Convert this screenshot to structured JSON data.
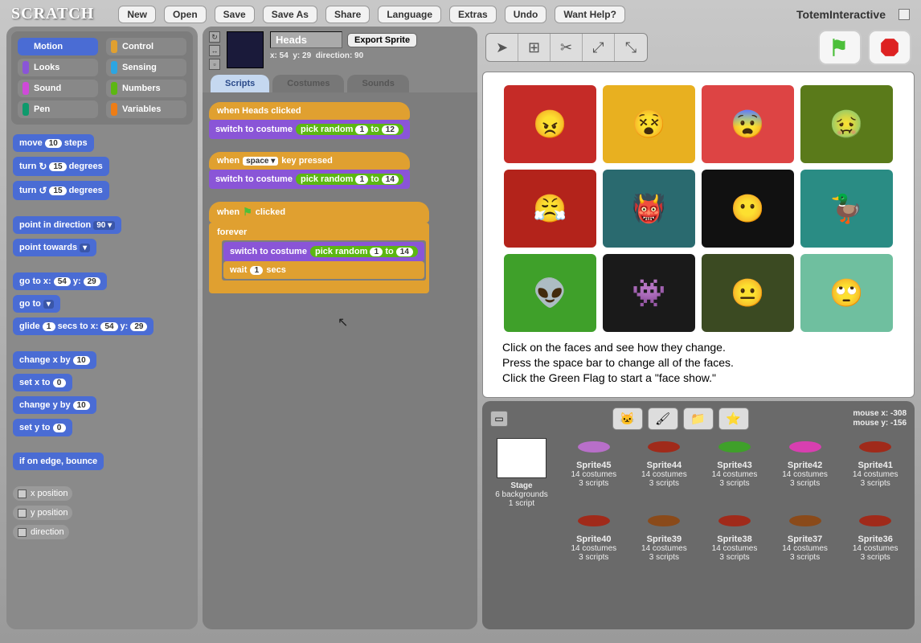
{
  "app": {
    "logo": "SCRATCH",
    "username": "TotemInteractive"
  },
  "menu": [
    "New",
    "Open",
    "Save",
    "Save As",
    "Share",
    "Language",
    "Extras",
    "Undo",
    "Want Help?"
  ],
  "categories": [
    {
      "name": "Motion",
      "color": "#4a6cd4",
      "active": true
    },
    {
      "name": "Control",
      "color": "#e0a030"
    },
    {
      "name": "Looks",
      "color": "#8a55d7"
    },
    {
      "name": "Sensing",
      "color": "#2ca5e2"
    },
    {
      "name": "Sound",
      "color": "#cf4ad9"
    },
    {
      "name": "Numbers",
      "color": "#5cb712"
    },
    {
      "name": "Pen",
      "color": "#0e9a6c"
    },
    {
      "name": "Variables",
      "color": "#ee7d16"
    }
  ],
  "motion_blocks": {
    "move_a": "move",
    "move_b": "steps",
    "move_n": "10",
    "turn_cw_a": "turn",
    "turn_cw_b": "degrees",
    "turn_cw_n": "15",
    "turn_ccw_a": "turn",
    "turn_ccw_b": "degrees",
    "turn_ccw_n": "15",
    "point_dir": "point in direction",
    "point_dir_n": "90 ▾",
    "point_toward": "point towards",
    "point_toward_v": "▾",
    "goto_xy": "go to x:",
    "goto_xy_x": "54",
    "goto_xy_mid": "y:",
    "goto_xy_y": "29",
    "goto": "go to",
    "goto_v": "▾",
    "glide_a": "glide",
    "glide_n": "1",
    "glide_b": "secs to x:",
    "glide_x": "54",
    "glide_c": "y:",
    "glide_y": "29",
    "chx": "change x by",
    "chx_n": "10",
    "setx": "set x to",
    "setx_n": "0",
    "chy": "change y by",
    "chy_n": "10",
    "sety": "set y to",
    "sety_n": "0",
    "bounce": "if on edge, bounce",
    "rep_x": "x position",
    "rep_y": "y position",
    "rep_d": "direction"
  },
  "sprite": {
    "name": "Heads",
    "x": "x: 54",
    "y": "y: 29",
    "dir": "direction: 90",
    "export": "Export Sprite",
    "tabs": [
      "Scripts",
      "Costumes",
      "Sounds"
    ],
    "active_tab": 0
  },
  "scripts": {
    "hat1": "when Heads clicked",
    "switch": "switch to costume",
    "pick": "pick random",
    "pick_a": "1",
    "pick_b1": "12",
    "pick_b2": "14",
    "pick_b3": "14",
    "hat2_a": "when",
    "hat2_key": "space ▾",
    "hat2_b": "key pressed",
    "hat3_a": "when",
    "hat3_b": "clicked",
    "forever": "forever",
    "wait_a": "wait",
    "wait_n": "1",
    "wait_b": "secs"
  },
  "stage_text": {
    "l1": "Click on the faces and see how they change.",
    "l2": "Press the space bar to change all of the faces.",
    "l3": "Click the Green Flag to start a \"face show.\""
  },
  "faces": [
    {
      "bg": "#c52b27",
      "emoji": "😠"
    },
    {
      "bg": "#e8b020",
      "emoji": "😵"
    },
    {
      "bg": "#d44",
      "emoji": "😨"
    },
    {
      "bg": "#5a7a1a",
      "emoji": "🤢"
    },
    {
      "bg": "#b3231b",
      "emoji": "😤"
    },
    {
      "bg": "#2a6a6f",
      "emoji": "👹"
    },
    {
      "bg": "#111",
      "emoji": "😶"
    },
    {
      "bg": "#2a8c84",
      "emoji": "🦆"
    },
    {
      "bg": "#3fa02a",
      "emoji": "👽"
    },
    {
      "bg": "#1a1a1a",
      "emoji": "👾"
    },
    {
      "bg": "#3b4a22",
      "emoji": "😐"
    },
    {
      "bg": "#6fbf9f",
      "emoji": "🙄"
    }
  ],
  "mouse": {
    "x": "mouse x:  -308",
    "y": "mouse y:  -156"
  },
  "stage_item": {
    "name": "Stage",
    "sub1": "6 backgrounds",
    "sub2": "1 script"
  },
  "sprites": [
    {
      "name": "Sprite45",
      "c": "14 costumes",
      "s": "3 scripts",
      "color": "#b86fc9"
    },
    {
      "name": "Sprite44",
      "c": "14 costumes",
      "s": "3 scripts",
      "color": "#a02a1a"
    },
    {
      "name": "Sprite43",
      "c": "14 costumes",
      "s": "3 scripts",
      "color": "#3fa02a"
    },
    {
      "name": "Sprite42",
      "c": "14 costumes",
      "s": "3 scripts",
      "color": "#d83fb0"
    },
    {
      "name": "Sprite41",
      "c": "14 costumes",
      "s": "3 scripts",
      "color": "#a02a1a"
    },
    {
      "name": "Sprite40",
      "c": "14 costumes",
      "s": "3 scripts",
      "color": "#a02a1a"
    },
    {
      "name": "Sprite39",
      "c": "14 costumes",
      "s": "3 scripts",
      "color": "#8a4a1a"
    },
    {
      "name": "Sprite38",
      "c": "14 costumes",
      "s": "3 scripts",
      "color": "#a02a1a"
    },
    {
      "name": "Sprite37",
      "c": "14 costumes",
      "s": "3 scripts",
      "color": "#8a4a1a"
    },
    {
      "name": "Sprite36",
      "c": "14 costumes",
      "s": "3 scripts",
      "color": "#a02a1a"
    }
  ]
}
